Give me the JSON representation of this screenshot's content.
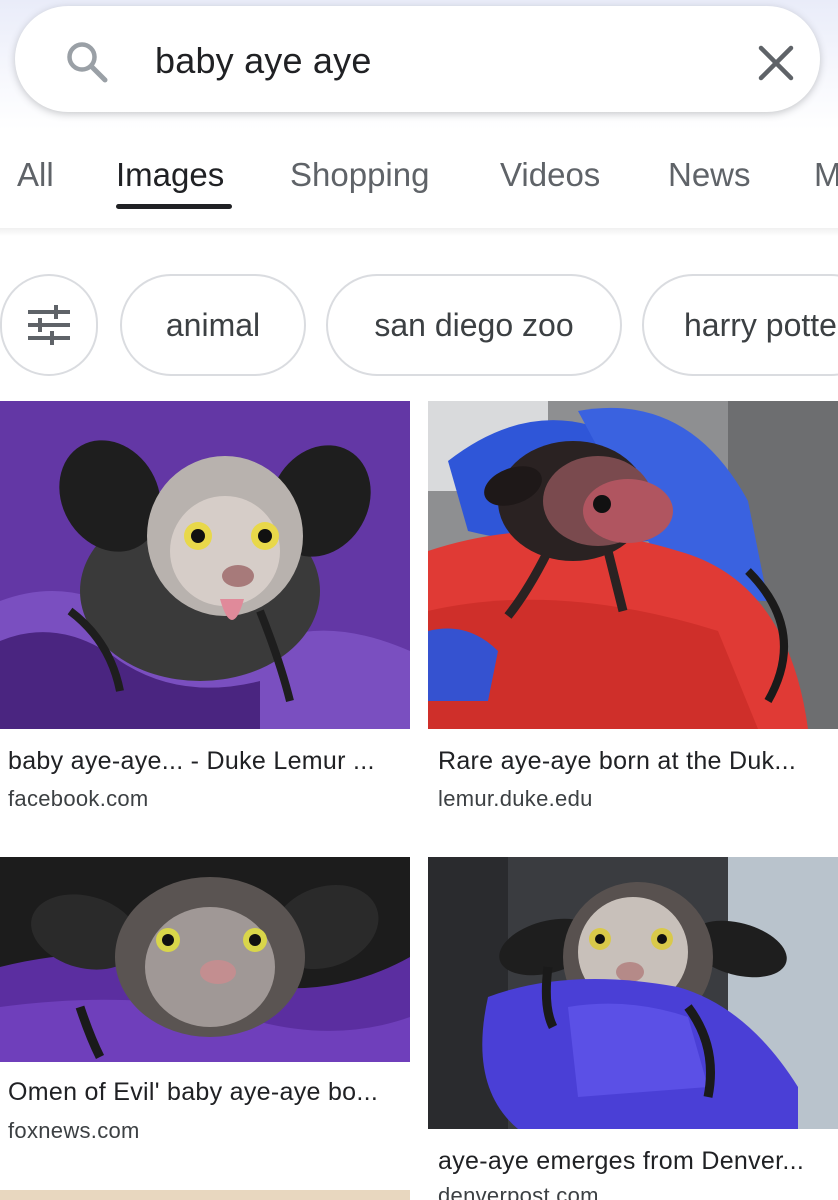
{
  "search": {
    "query": "baby aye aye"
  },
  "tabs": [
    {
      "label": "All",
      "active": false
    },
    {
      "label": "Images",
      "active": true
    },
    {
      "label": "Shopping",
      "active": false
    },
    {
      "label": "Videos",
      "active": false
    },
    {
      "label": "News",
      "active": false
    },
    {
      "label": "M",
      "active": false
    }
  ],
  "chips": {
    "filter_icon": "tune-icon",
    "items": [
      "animal",
      "san diego zoo",
      "harry potte"
    ]
  },
  "results": [
    {
      "title": "baby aye-aye... - Duke Lemur ...",
      "source": "facebook.com"
    },
    {
      "title": "Rare aye-aye born at the Duk...",
      "source": "lemur.duke.edu"
    },
    {
      "title": "Omen of Evil' baby aye-aye bo...",
      "source": "foxnews.com"
    },
    {
      "title": "aye-aye emerges from Denver...",
      "source": "denverpost.com"
    }
  ],
  "colors": {
    "tab_active": "#202124",
    "tab_inactive": "#5f6368",
    "chip_border": "#dadce0"
  }
}
